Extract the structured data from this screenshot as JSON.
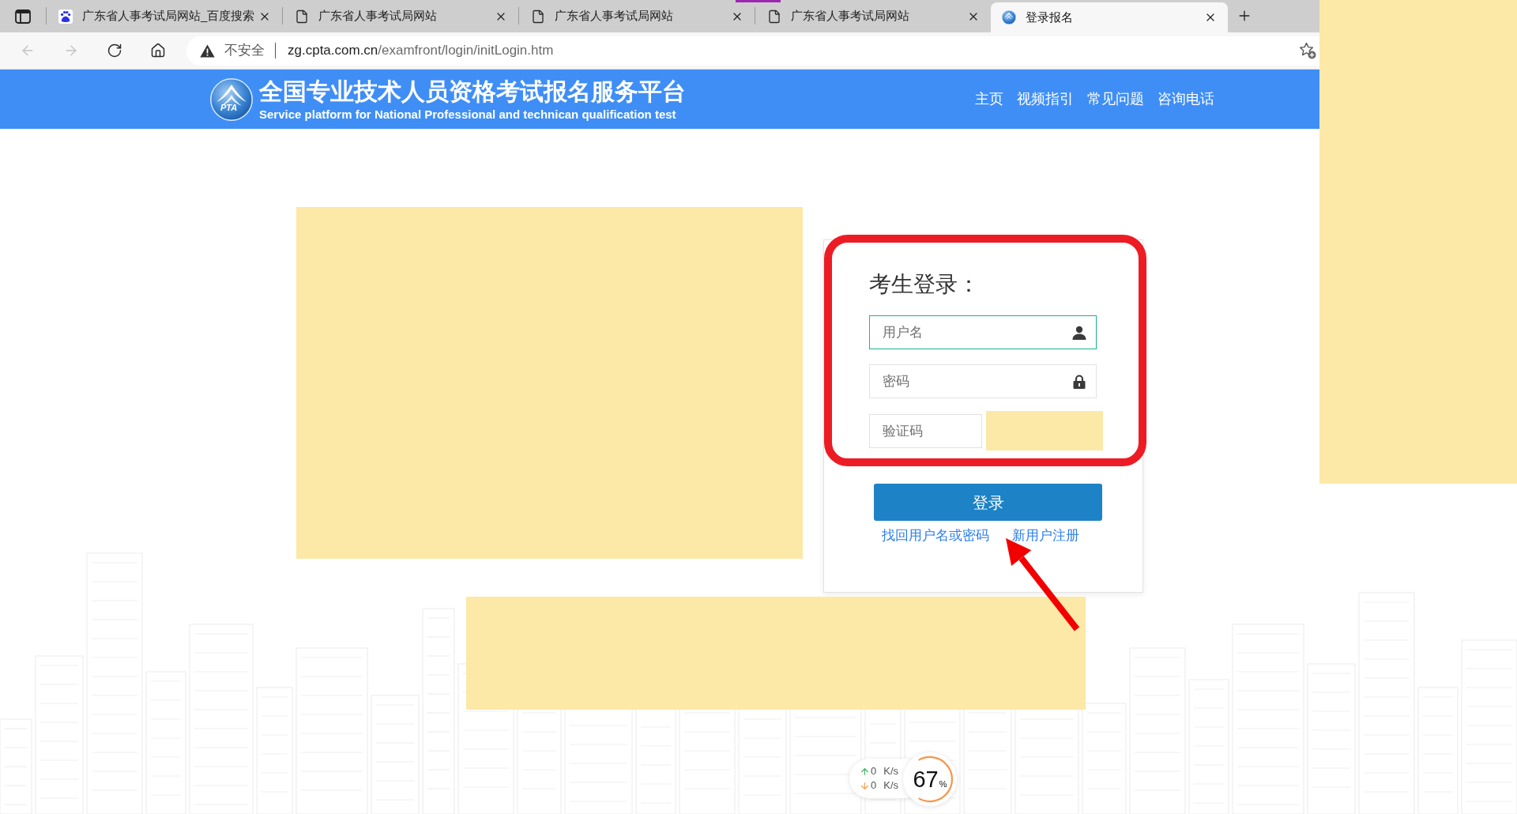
{
  "browser": {
    "tabs": [
      {
        "kind": "search",
        "title": "广东省人事考试局网站_百度搜索",
        "selected": false
      },
      {
        "kind": "page",
        "title": "广东省人事考试局网站",
        "selected": false
      },
      {
        "kind": "page",
        "title": "广东省人事考试局网站",
        "selected": false
      },
      {
        "kind": "page",
        "title": "广东省人事考试局网站",
        "selected": false
      },
      {
        "kind": "site",
        "title": "登录报名",
        "selected": true
      }
    ],
    "toolbar": {
      "back": {
        "disabled": true
      },
      "forward": {
        "disabled": true
      }
    },
    "address_bar": {
      "security_label": "不安全",
      "host": "zg.cpta.com.cn",
      "path": "/examfront/login/initLogin.htm"
    }
  },
  "site_header": {
    "logo_text": "PTA",
    "title": "全国专业技术人员资格考试报名服务平台",
    "subtitle": "Service platform for National Professional and technican qualification test",
    "nav": [
      "主页",
      "视频指引",
      "常见问题",
      "咨询电话"
    ]
  },
  "login": {
    "title": "考生登录：",
    "fields": [
      {
        "kind": "username",
        "placeholder": "用户名",
        "focused": true
      },
      {
        "kind": "password",
        "placeholder": "密码",
        "focused": false
      },
      {
        "kind": "captcha",
        "placeholder": "验证码",
        "focused": false
      }
    ],
    "submit": "登录",
    "links": [
      "找回用户名或密码",
      "新用户注册"
    ]
  },
  "network_widget": {
    "upload": {
      "value": "0",
      "unit": "K/s"
    },
    "download": {
      "value": "0",
      "unit": "K/s"
    },
    "memory": {
      "value": "67",
      "unit": "%",
      "level": 0.67
    }
  }
}
